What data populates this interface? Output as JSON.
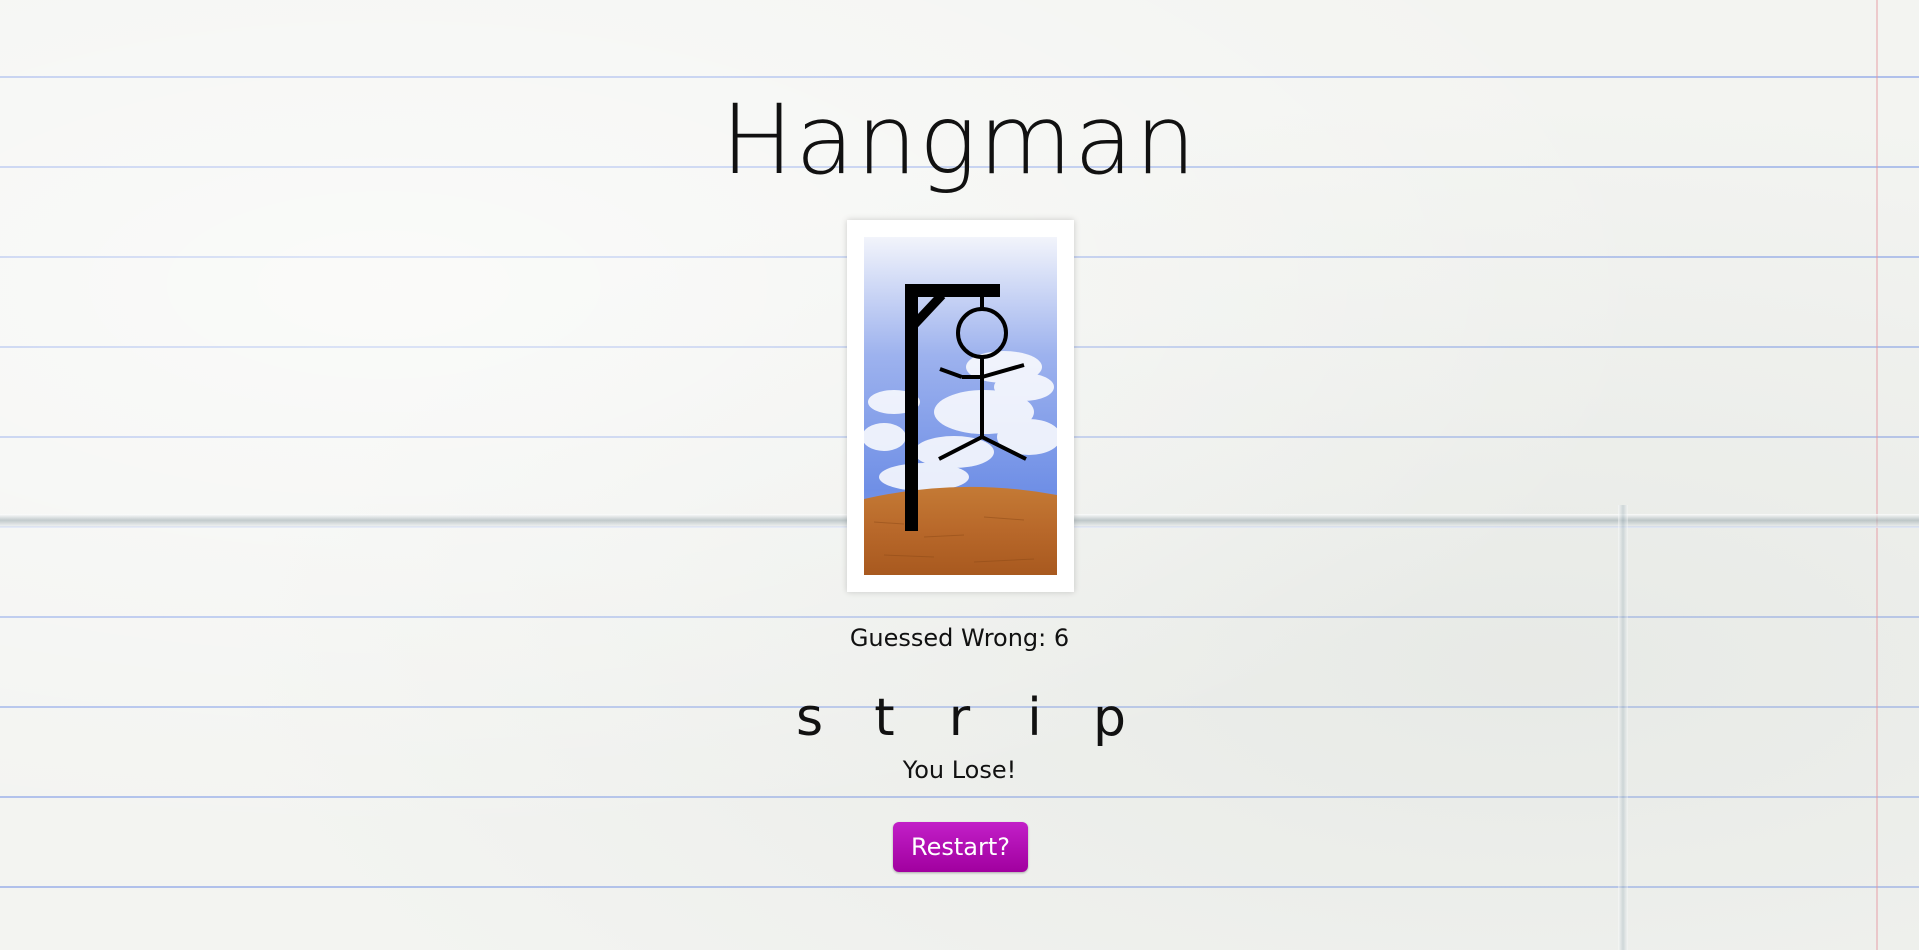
{
  "game": {
    "title": "Hangman",
    "wrong_guesses_label": "Guessed Wrong: 6",
    "word_letters": [
      "s",
      "t",
      "r",
      "i",
      "p"
    ],
    "result_message": "You Lose!",
    "restart_label": "Restart?"
  },
  "colors": {
    "button": "#b10fb3",
    "ruled_line": "#7896e6",
    "sky": "#6f8fe6",
    "ground": "#b8682a"
  },
  "icons": {
    "illustration": "hangman-gallows-icon"
  }
}
